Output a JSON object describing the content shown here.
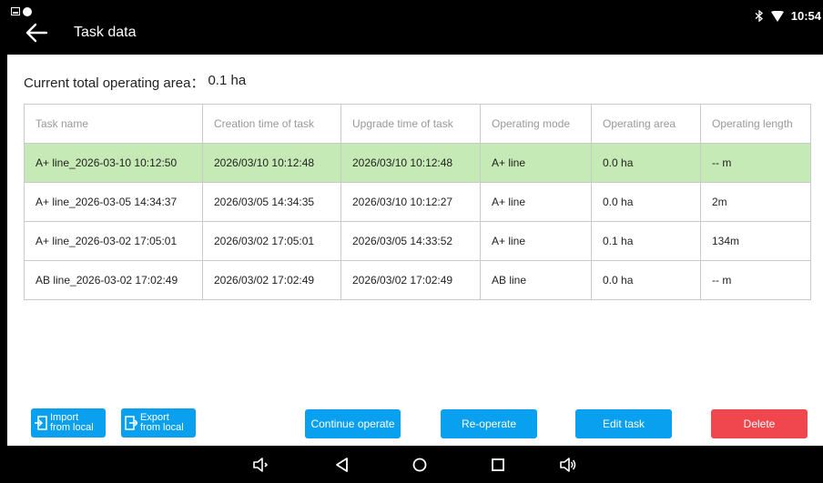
{
  "titlebar": {
    "title": "Task data",
    "time": "10:54",
    "icons": [
      "notification-icon",
      "status-dot-icon",
      "back-arrow-icon",
      "bluetooth-icon",
      "wifi-icon"
    ]
  },
  "summary": {
    "label": "Current total operating area：",
    "value": "0.1 ha"
  },
  "table": {
    "headers": [
      "Task name",
      "Creation time of task",
      "Upgrade time of task",
      "Operating mode",
      "Operating area",
      "Operating length"
    ],
    "rows": [
      [
        "A+ line_2026-03-10 10:12:50",
        "2026/03/10 10:12:48",
        "2026/03/10 10:12:48",
        "A+ line",
        "0.0 ha",
        "-- m"
      ],
      [
        "A+ line_2026-03-05 14:34:37",
        "2026/03/05 14:34:35",
        "2026/03/10 10:12:27",
        "A+ line",
        "0.0 ha",
        "2m"
      ],
      [
        "A+ line_2026-03-02 17:05:01",
        "2026/03/02 17:05:01",
        "2026/03/05 14:33:52",
        "A+ line",
        "0.1 ha",
        "134m"
      ],
      [
        "AB line_2026-03-02 17:02:49",
        "2026/03/02 17:02:49",
        "2026/03/02 17:02:49",
        "AB line",
        "0.0 ha",
        "-- m"
      ]
    ],
    "selected_row": 0,
    "selected_color": "#c6eab5"
  },
  "buttons": {
    "import": "Import\nfrom local",
    "export": "Export\nfrom local",
    "continue": "Continue operate",
    "reoperate": "Re-operate",
    "edit": "Edit task",
    "delete": "Delete",
    "accent_color": "#0aa0f0",
    "danger_color": "#f0474f"
  },
  "navbar": {
    "icons": [
      "volume-down-icon",
      "back-triangle-icon",
      "home-circle-icon",
      "recents-square-icon",
      "volume-up-icon"
    ]
  }
}
